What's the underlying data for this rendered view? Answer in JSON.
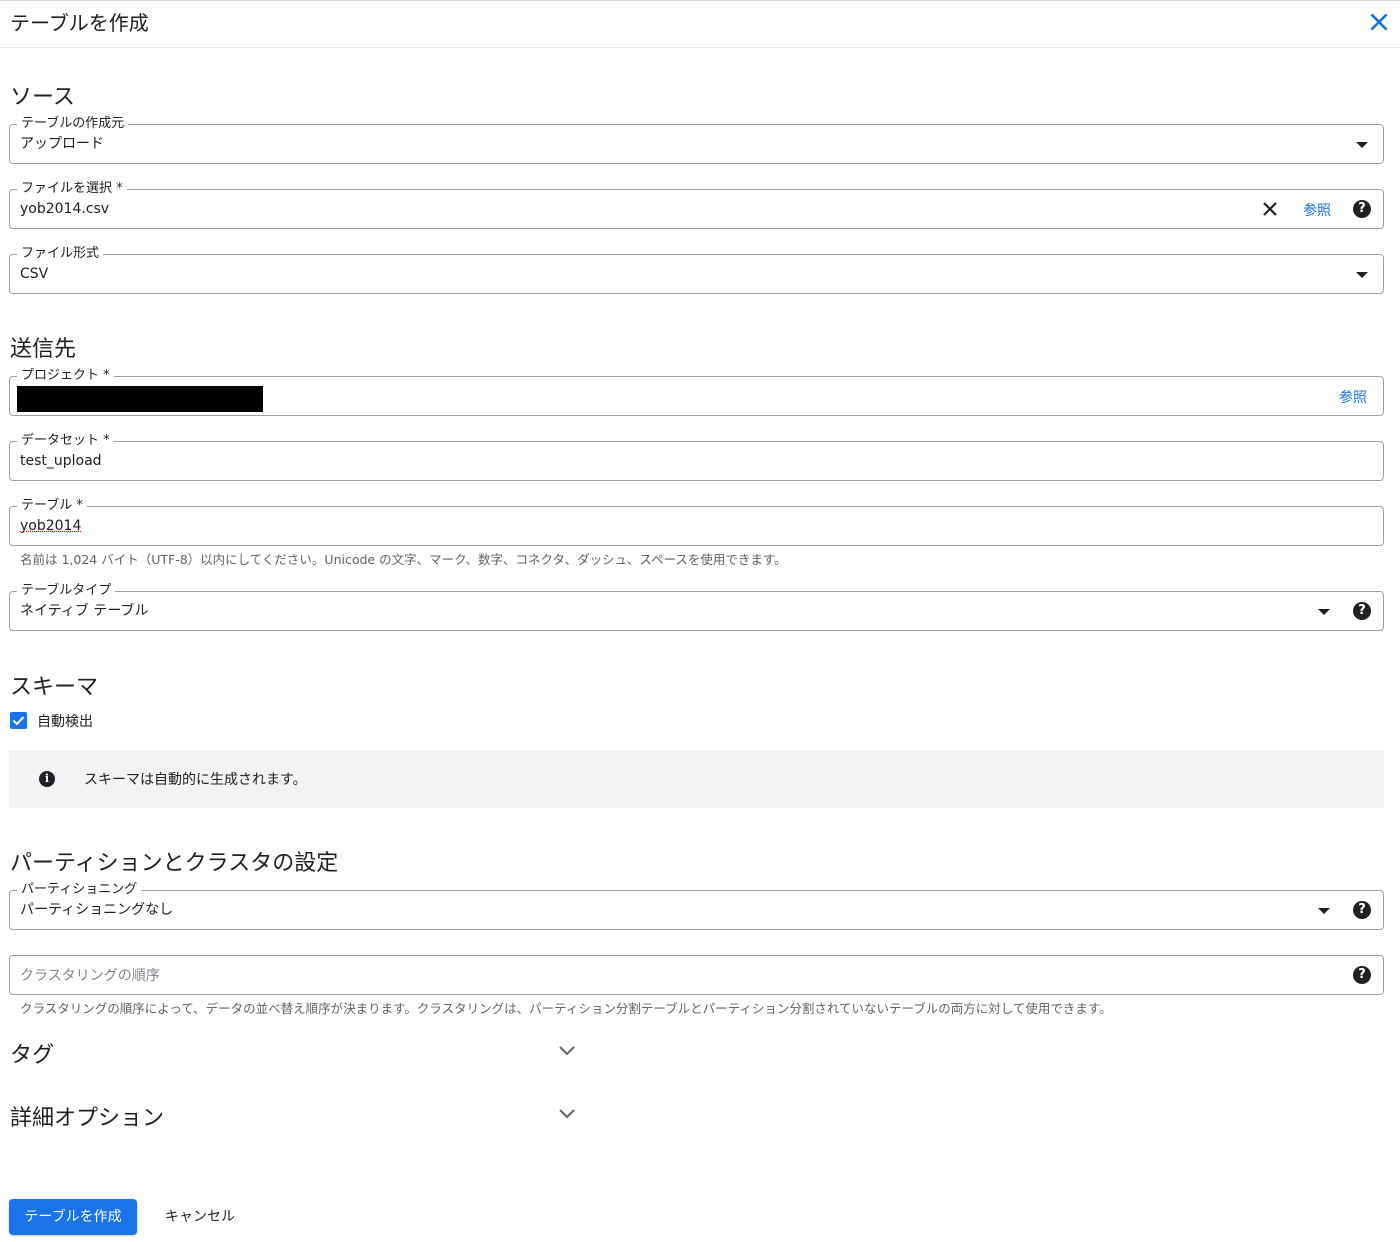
{
  "header": {
    "title": "テーブルを作成"
  },
  "sections": {
    "source": "ソース",
    "destination": "送信先",
    "schema": "スキーマ",
    "partition": "パーティションとクラスタの設定"
  },
  "source": {
    "create_from": {
      "label": "テーブルの作成元",
      "value": "アップロード"
    },
    "file": {
      "label": "ファイルを選択 *",
      "value": "yob2014.csv",
      "browse": "参照"
    },
    "format": {
      "label": "ファイル形式",
      "value": "CSV"
    }
  },
  "destination": {
    "project": {
      "label": "プロジェクト *",
      "browse": "参照"
    },
    "dataset": {
      "label": "データセット *",
      "value": "test_upload"
    },
    "table": {
      "label": "テーブル *",
      "value": "yob2014",
      "hint": "名前は 1,024 バイト（UTF-8）以内にしてください。Unicode の文字、マーク、数字、コネクタ、ダッシュ、スペースを使用できます。"
    },
    "table_type": {
      "label": "テーブルタイプ",
      "value": "ネイティブ テーブル"
    }
  },
  "schema": {
    "auto_detect": {
      "label": "自動検出",
      "checked": true
    },
    "info": "スキーマは自動的に生成されます。"
  },
  "partition": {
    "partitioning": {
      "label": "パーティショニング",
      "value": "パーティショニングなし"
    },
    "clustering": {
      "placeholder": "クラスタリングの順序",
      "hint": "クラスタリングの順序によって、データの並べ替え順序が決まります。クラスタリングは、パーティション分割テーブルとパーティション分割されていないテーブルの両方に対して使用できます。"
    }
  },
  "expanders": {
    "tags": "タグ",
    "advanced": "詳細オプション"
  },
  "actions": {
    "create": "テーブルを作成",
    "cancel": "キャンセル"
  },
  "icons": {
    "close": "close-icon",
    "dropdown": "dropdown-arrow-icon",
    "help": "help-icon",
    "clear": "clear-icon",
    "info": "info-icon",
    "chevron": "chevron-down-icon",
    "check": "check-icon"
  },
  "colors": {
    "accent": "#1a73e8",
    "text": "#202124",
    "border": "#9aa0a6",
    "info_bg": "#f1f3f4"
  }
}
